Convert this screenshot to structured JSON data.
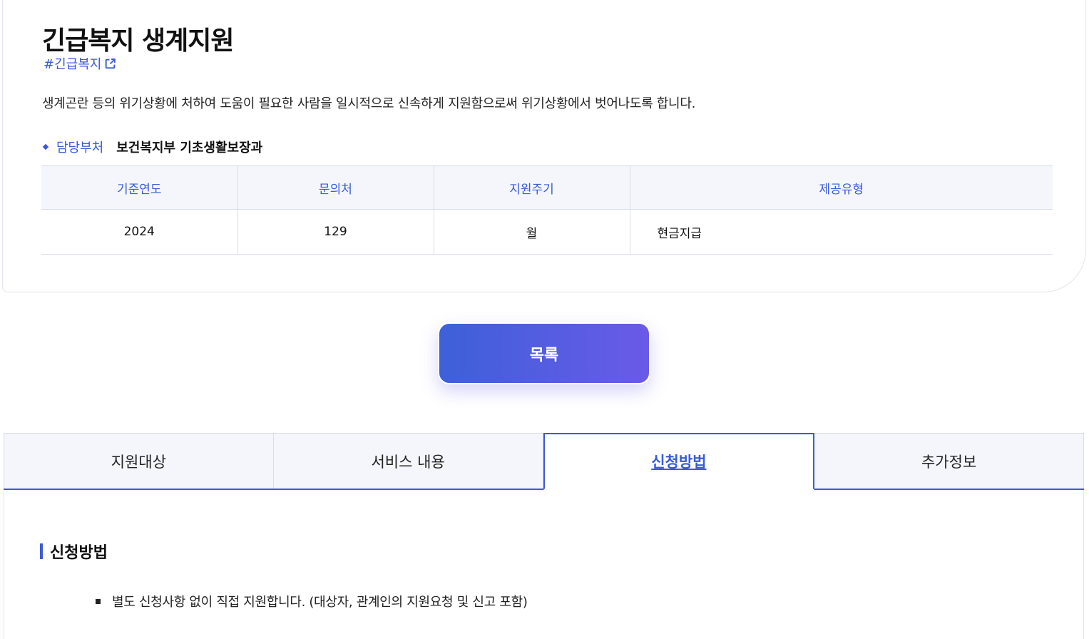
{
  "header": {
    "title": "긴급복지 생계지원",
    "hashtag": "#긴급복지",
    "description": "생계곤란 등의 위기상황에 처하여 도움이 필요한 사람을 일시적으로 신속하게 지원함으로써 위기상황에서 벗어나도록 합니다.",
    "dept_label": "담당부처",
    "dept_value": "보건복지부 기초생활보장과"
  },
  "info_table": {
    "headers": [
      "기준연도",
      "문의처",
      "지원주기",
      "제공유형"
    ],
    "row": [
      "2024",
      "129",
      "월",
      "현금지급"
    ]
  },
  "list_button": "목록",
  "tabs": [
    "지원대상",
    "서비스 내용",
    "신청방법",
    "추가정보"
  ],
  "active_tab": "신청방법",
  "section": {
    "title": "신청방법",
    "items": [
      "별도 신청사항 없이 직접 지원합니다. (대상자, 관계인의 지원요청 및 신고 포함)"
    ]
  },
  "colors": {
    "accent": "#3b5bd6",
    "button_gradient_end": "#6a5ae8",
    "header_bg": "#f4f6fb"
  },
  "icons": {
    "hashtag_link": "external-link-icon"
  }
}
